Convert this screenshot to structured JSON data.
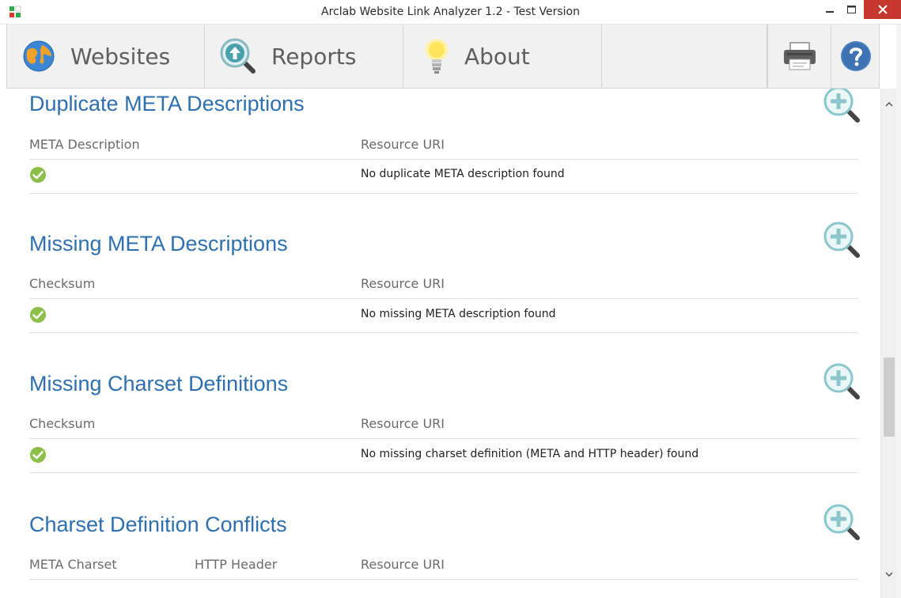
{
  "window": {
    "title": "Arclab Website Link Analyzer 1.2 - Test Version"
  },
  "toolbar": {
    "websites_label": "Websites",
    "reports_label": "Reports",
    "about_label": "About"
  },
  "icons": {
    "app": "app-icon",
    "websites": "globe-icon",
    "reports": "magnifier-upload-icon",
    "about": "lightbulb-icon",
    "print": "printer-icon",
    "help": "help-icon",
    "zoom": "zoom-in-icon",
    "ok": "checkmark-icon"
  },
  "colors": {
    "accent": "#2e6fb0",
    "ok": "#8cbf4a",
    "close": "#c7372f",
    "zoom": "#8bc6cc"
  },
  "sections": [
    {
      "title": "Duplicate META Descriptions",
      "col1": "META Description",
      "col3": "Resource URI",
      "message": "No duplicate META description found"
    },
    {
      "title": "Missing META Descriptions",
      "col1": "Checksum",
      "col3": "Resource URI",
      "message": "No missing META description found"
    },
    {
      "title": "Missing Charset Definitions",
      "col1": "Checksum",
      "col3": "Resource URI",
      "message": "No missing charset definition (META and HTTP header) found"
    },
    {
      "title": "Charset Definition Conflicts",
      "col1": "META Charset",
      "col2": "HTTP Header",
      "col3": "Resource URI"
    }
  ]
}
